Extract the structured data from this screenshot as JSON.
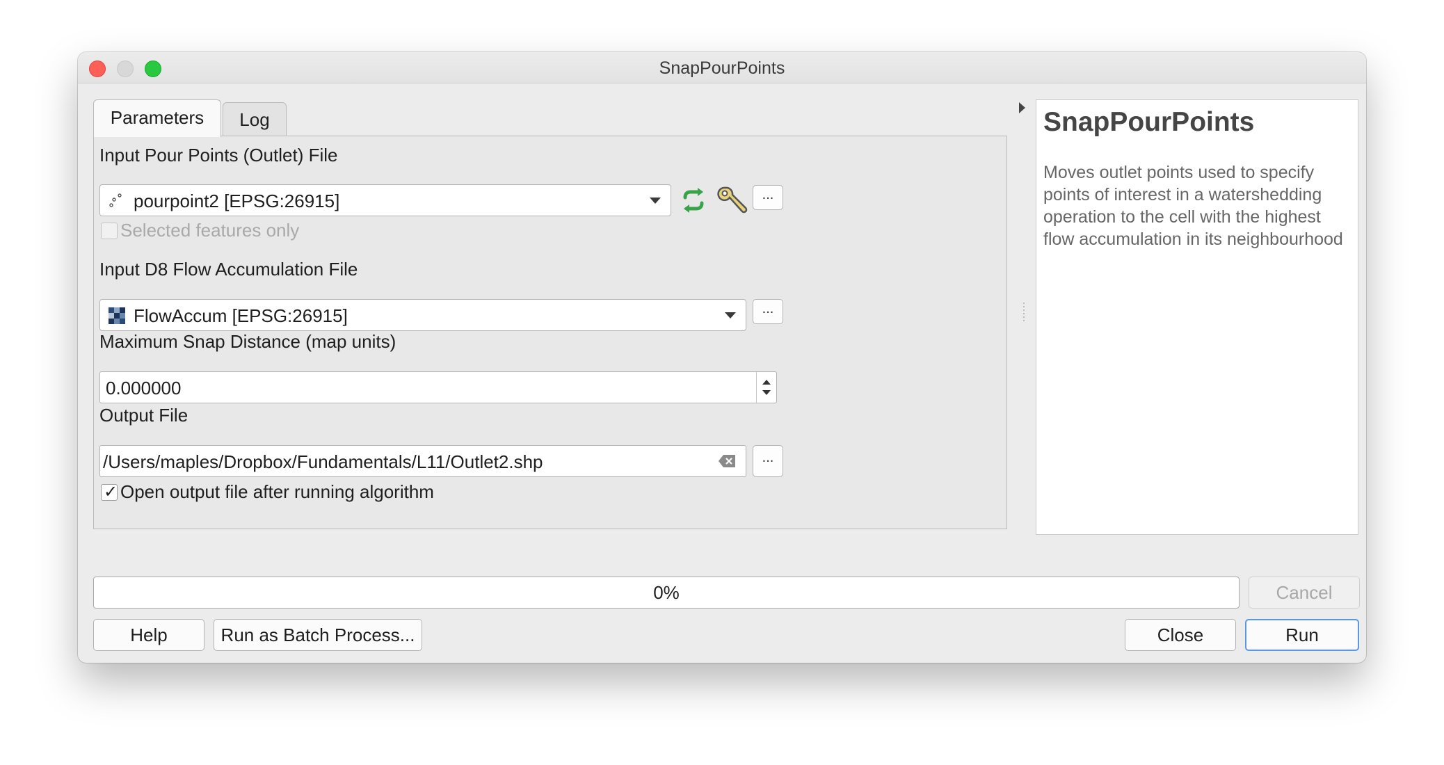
{
  "window": {
    "title": "SnapPourPoints"
  },
  "tabs": [
    {
      "label": "Parameters"
    },
    {
      "label": "Log"
    }
  ],
  "params": {
    "input_pour_points": {
      "label": "Input Pour Points (Outlet) File",
      "value": "pourpoint2 [EPSG:26915]",
      "browse_label": "..."
    },
    "selected_only": {
      "label": "Selected features only",
      "checked": false,
      "enabled": false
    },
    "flow_accum": {
      "label": "Input D8 Flow Accumulation File",
      "value": "FlowAccum [EPSG:26915]",
      "browse_label": "..."
    },
    "snap_distance": {
      "label": "Maximum Snap Distance (map units)",
      "value": "0.000000"
    },
    "output_file": {
      "label": "Output File",
      "value": "/Users/maples/Dropbox/Fundamentals/L11/Outlet2.shp",
      "browse_label": "..."
    },
    "open_output": {
      "label": "Open output file after running algorithm",
      "checked": true
    }
  },
  "help": {
    "title": "SnapPourPoints",
    "description": "Moves outlet points used to specify points of interest in a watershedding operation to the cell with the highest flow accumulation in its neighbourhood"
  },
  "progress": {
    "text": "0%",
    "value": 0
  },
  "buttons": {
    "cancel": "Cancel",
    "help": "Help",
    "batch": "Run as Batch Process...",
    "close": "Close",
    "run": "Run"
  },
  "icons": {
    "iterate": "iterate-icon",
    "settings": "wrench-icon",
    "point_layer": "point-layer-icon",
    "raster_layer": "raster-layer-icon",
    "clear": "clear-icon"
  },
  "colors": {
    "accent": "#5a98e6",
    "iterate_green": "#3aa34a"
  }
}
